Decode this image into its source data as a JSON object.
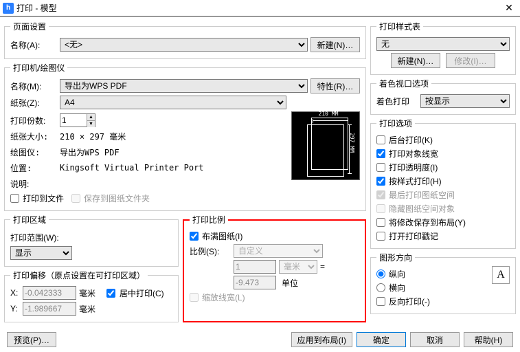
{
  "title": "打印 - 模型",
  "pageSetup": {
    "legend": "页面设置",
    "nameLabel": "名称(A):",
    "nameValue": "<无>",
    "newBtn": "新建(N)…"
  },
  "printer": {
    "legend": "打印机/绘图仪",
    "nameLabel": "名称(M):",
    "nameValue": "导出为WPS PDF",
    "propsBtn": "特性(R)…",
    "paperLabel": "纸张(Z):",
    "paperValue": "A4",
    "copiesLabel": "打印份数:",
    "copiesValue": "1",
    "sizeLabel": "纸张大小:",
    "sizeValue": "210 × 297 毫米",
    "plotterLabel": "绘图仪:",
    "plotterValue": "导出为WPS PDF",
    "locationLabel": "位置:",
    "locationValue": "Kingsoft Virtual Printer Port",
    "descLabel": "说明:",
    "toFile": "打印到文件",
    "saveSheet": "保存到图纸文件夹",
    "previewW": "210 MM",
    "previewH": "297 MM"
  },
  "area": {
    "legend": "打印区域",
    "rangeLabel": "打印范围(W):",
    "rangeValue": "显示"
  },
  "offset": {
    "legend": "打印偏移（原点设置在可打印区域）",
    "xLabel": "X:",
    "xValue": "-0.042333",
    "yLabel": "Y:",
    "yValue": "-1.989667",
    "unit": "毫米",
    "center": "居中打印(C)"
  },
  "scale": {
    "legend": "打印比例",
    "fit": "布满图纸(I)",
    "ratioLabel": "比例(S):",
    "ratioValue": "自定义",
    "num": "1",
    "numUnit": "毫米",
    "eq": "=",
    "den": "-9.473",
    "denUnit": "单位",
    "scaleLW": "缩放线宽(L)"
  },
  "styleTable": {
    "legend": "打印样式表",
    "value": "无",
    "newBtn": "新建(N)…",
    "editBtn": "修改(I)…"
  },
  "viewport": {
    "legend": "着色视口选项",
    "shadeLabel": "着色打印",
    "shadeValue": "按显示"
  },
  "options": {
    "legend": "打印选项",
    "background": "后台打印(K)",
    "lineweight": "打印对象线宽",
    "transparency": "打印透明度(I)",
    "byStyle": "按样式打印(H)",
    "lastSpace": "最后打印图纸空间",
    "hideSpace": "隐藏图纸空间对象",
    "saveLayout": "将修改保存到布局(Y)",
    "stamp": "打开打印戳记"
  },
  "orientation": {
    "legend": "图形方向",
    "portrait": "纵向",
    "landscape": "横向",
    "reverse": "反向打印(-)",
    "iconText": "A"
  },
  "footer": {
    "preview": "预览(P)…",
    "applyLayout": "应用到布局(I)",
    "ok": "确定",
    "cancel": "取消",
    "help": "帮助(H)"
  }
}
